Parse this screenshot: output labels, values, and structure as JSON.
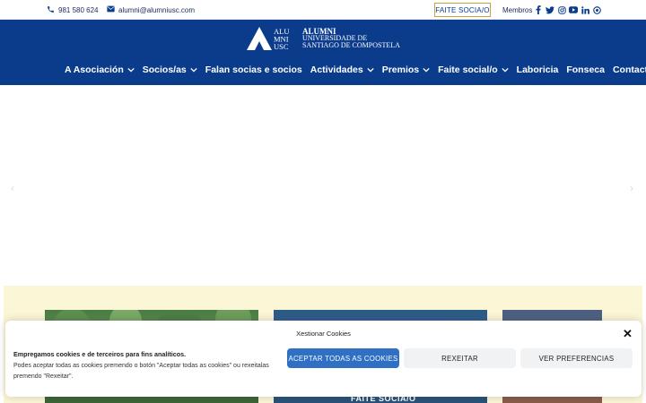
{
  "topbar": {
    "phone": "981 580 624",
    "email": "alumni@alumniusc.com",
    "join_label": "FAITE SOCIA/O",
    "members_label": "Membros",
    "social_icons": [
      "facebook-icon",
      "twitter-icon",
      "instagram-icon",
      "youtube-icon",
      "linkedin-icon",
      "flickr-icon"
    ]
  },
  "logo": {
    "mark_lines": [
      "ALU",
      "MNI",
      "USC"
    ],
    "line1": "ALUMNI",
    "line2": "UNIVERSIDADE DE",
    "line3": "SANTIAGO DE COMPOSTELA"
  },
  "nav": {
    "items": [
      {
        "label": "A Asociación",
        "dropdown": true
      },
      {
        "label": "Socios/as",
        "dropdown": true
      },
      {
        "label": "Falan socias e socios",
        "dropdown": false
      },
      {
        "label": "Actividades",
        "dropdown": true
      },
      {
        "label": "Premios",
        "dropdown": true
      },
      {
        "label": "Faite social/o",
        "dropdown": true
      },
      {
        "label": "Laboricia",
        "dropdown": false
      },
      {
        "label": "Fonseca",
        "dropdown": false
      },
      {
        "label": "Contacto",
        "dropdown": false
      }
    ]
  },
  "hero": {
    "prev_arrow": "‹",
    "next_arrow": "›"
  },
  "cards": {
    "card2_label": "FAITE SOCIA/O"
  },
  "cookie": {
    "title": "Xestionar Cookies",
    "close": "✕",
    "strong_text": "Empregamos cookies e de terceiros para fins analíticos.",
    "body_text": "Podes aceptar todas as cookies premendo o botón \"Aceptar todas as cookies\" ou rexeitalas premendo \"Rexeitar\".",
    "accept_label": "ACEPTAR TODAS AS COOKIES",
    "reject_label": "REXEITAR",
    "prefs_label": "VER PREFERENCIAS"
  },
  "colors": {
    "brand_blue": "#0b3c8c",
    "accent_gold": "#c8a43a",
    "band_yellow": "#fbf6d6",
    "accept_blue": "#2f6fc4"
  }
}
